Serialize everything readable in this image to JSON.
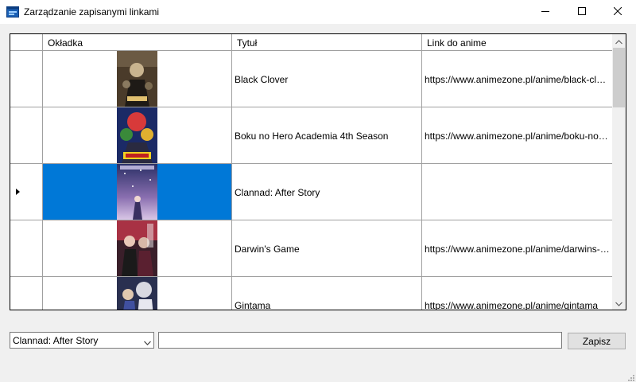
{
  "window": {
    "title": "Zarządzanie zapisanymi linkami",
    "icon": "app-window-icon",
    "controls": [
      "minimize-icon",
      "maximize-icon",
      "close-icon"
    ]
  },
  "grid": {
    "columns": [
      "Okładka",
      "Tytuł",
      "Link do anime"
    ],
    "rows": [
      {
        "title": "Black Clover",
        "link": "https://www.animezone.pl/anime/black-clover...",
        "selected": false
      },
      {
        "title": "Boku no Hero Academia 4th Season",
        "link": "https://www.animezone.pl/anime/boku-no-her...",
        "selected": false
      },
      {
        "title": "Clannad: After Story",
        "link": "",
        "selected": true
      },
      {
        "title": "Darwin's Game",
        "link": "https://www.animezone.pl/anime/darwins-game",
        "selected": false
      },
      {
        "title": "Gintama",
        "link": "https://www.animezone.pl/anime/gintama",
        "selected": false
      }
    ],
    "selection_color": "#0078d7"
  },
  "footer": {
    "dropdown_value": "Clannad: After Story",
    "link_input_value": "",
    "save_label": "Zapisz"
  }
}
